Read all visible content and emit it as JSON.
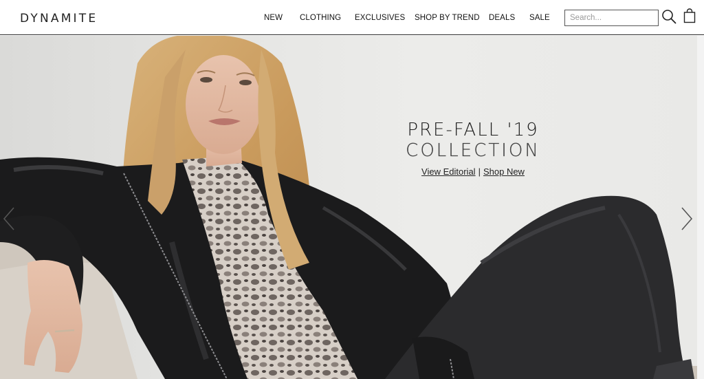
{
  "brand": {
    "logo_text": "DYNAMITE"
  },
  "nav": {
    "items": [
      {
        "label": "NEW"
      },
      {
        "label": "CLOTHING"
      },
      {
        "label": "EXCLUSIVES"
      },
      {
        "label": "SHOP BY TREND"
      },
      {
        "label": "DEALS"
      },
      {
        "label": "SALE"
      }
    ]
  },
  "search": {
    "placeholder": "Search...",
    "value": ""
  },
  "icons": {
    "search": "search-icon",
    "bag": "shopping-bag-icon",
    "prev": "chevron-left-icon",
    "next": "chevron-right-icon"
  },
  "hero": {
    "title_line1": "PRE-FALL '19",
    "title_line2": "COLLECTION",
    "link_editorial": "View Editorial",
    "separator": "|",
    "link_shop": "Shop New"
  },
  "colors": {
    "header_border": "#2a2a2a",
    "hero_bg": "#e8e8e6",
    "text": "#111111"
  }
}
